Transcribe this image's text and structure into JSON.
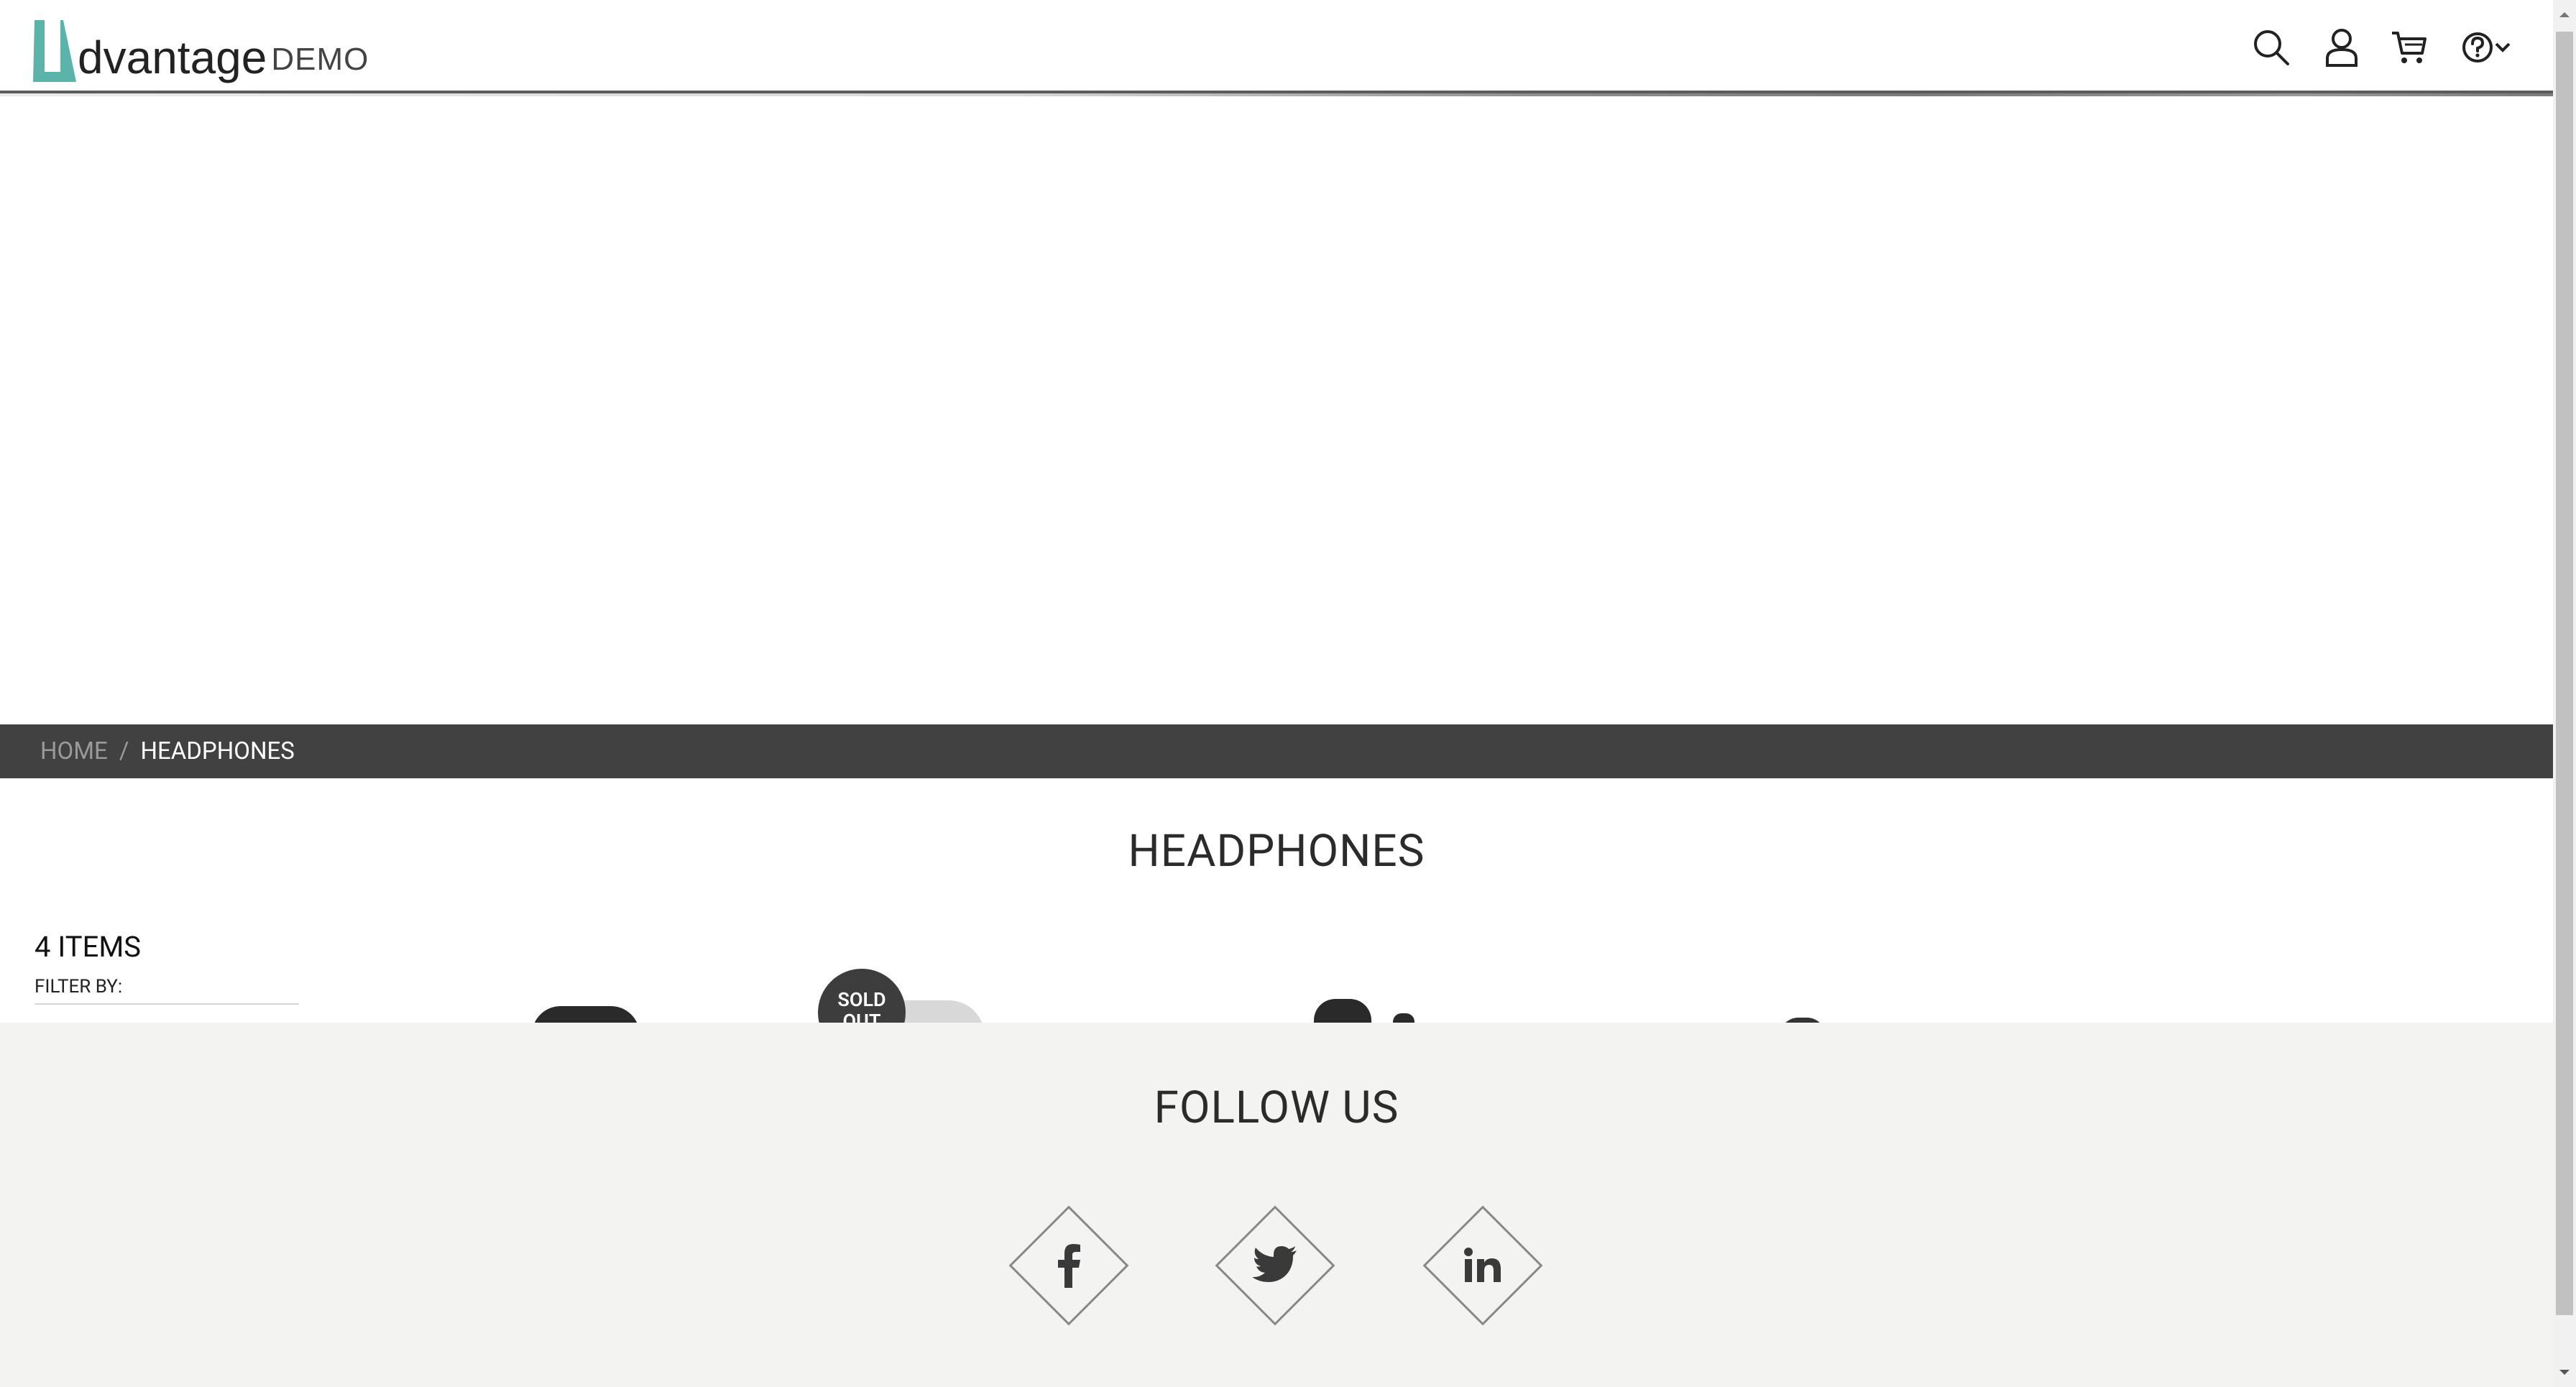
{
  "header": {
    "logo_word": "dvantage",
    "logo_demo": "DEMO",
    "icons": [
      "search-icon",
      "user-icon",
      "cart-icon",
      "help-icon"
    ]
  },
  "breadcrumb": {
    "home": "HOME",
    "separator": "/",
    "current": "HEADPHONES"
  },
  "category": {
    "title": "HEADPHONES",
    "items_count": "4 ITEMS",
    "filter_label": "FILTER BY:"
  },
  "products": {
    "sold_out_badge": "SOLD OUT"
  },
  "footer": {
    "follow_title": "FOLLOW US",
    "social": [
      "facebook-icon",
      "twitter-icon",
      "linkedin-icon"
    ]
  },
  "colors": {
    "brand_teal": "#5bb3a9",
    "breadcrumb_bg": "#414141",
    "footer_bg": "#f3f3f1"
  }
}
